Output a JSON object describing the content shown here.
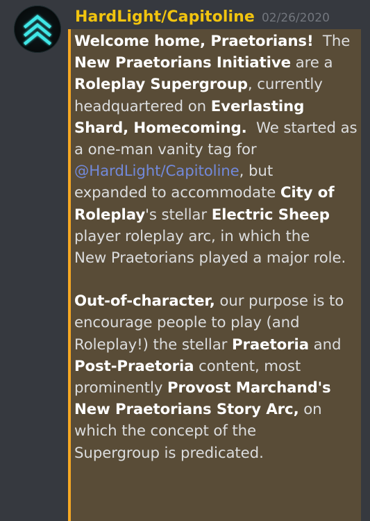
{
  "message": {
    "author": "HardLight/Capitoline",
    "timestamp": "02/26/2020",
    "avatar_icon": "teal-double-chevron-up-icon",
    "colors": {
      "background": "#36393f",
      "author": "#f1c40f",
      "quote_border": "#f6a823",
      "quote_bg": "#594c37",
      "mention": "#7289da"
    },
    "t": {
      "l1a": "Welcome home, Praetorians!",
      "l1b": "  The",
      "l2a": "New Praetorians Initiative",
      "l2b": " are a",
      "l3a": "Roleplay Supergroup",
      "l3b": ", currently",
      "l4a": "headquartered on ",
      "l4b": "Everlasting",
      "l5a": "Shard, Homecoming.",
      "l5b": "  We started as",
      "l6": "a one-man vanity tag for",
      "l7a": "@HardLight/Capitoline",
      "l7b": ", but",
      "l8a": "expanded to accommodate ",
      "l8b": "City of",
      "l9a": "Roleplay",
      "l9b": "'s stellar ",
      "l9c": "Electric Sheep",
      "l10": "player roleplay arc, in which the",
      "l11": "New Praetorians played a major role.",
      "p2l1a": "Out-of-character,",
      "p2l1b": " our purpose is to",
      "p2l2": "encourage people to play (and",
      "p2l3a": "Roleplay!) the stellar ",
      "p2l3b": "Praetoria",
      "p2l3c": " and",
      "p2l4a": "Post-Praetoria",
      "p2l4b": " content, most",
      "p2l5a": "prominently ",
      "p2l5b": "Provost Marchand's",
      "p2l6a": "New Praetorians Story Arc,",
      "p2l6b": " on",
      "p2l7": "which the concept of the",
      "p2l8": "Supergroup is predicated."
    }
  }
}
